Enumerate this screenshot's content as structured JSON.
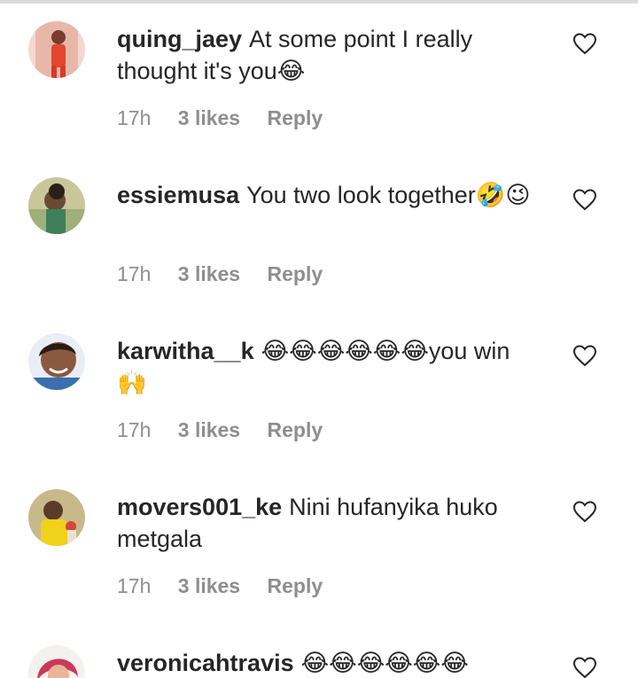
{
  "comments": [
    {
      "user": "quing_jaey",
      "text": "At some point I really thought it's you😂",
      "time": "17h",
      "likes": "3 likes",
      "reply": "Reply"
    },
    {
      "user": "essiemusa",
      "text": "You two look together🤣😉",
      "time": "17h",
      "likes": "3 likes",
      "reply": "Reply"
    },
    {
      "user": "karwitha__k",
      "text": "😂😂😂😂😂😂you win 🙌",
      "time": "17h",
      "likes": "3 likes",
      "reply": "Reply"
    },
    {
      "user": "movers001_ke",
      "text": "Nini hufanyika huko metgala",
      "time": "17h",
      "likes": "3 likes",
      "reply": "Reply"
    },
    {
      "user": "veronicahtravis",
      "text": "😂😂😂😂😂😂",
      "time": "",
      "likes": "",
      "reply": ""
    }
  ],
  "icons": {
    "like": "heart-outline-icon"
  },
  "colors": {
    "text": "#262626",
    "meta": "#8e8e8e",
    "divider": "#dbdbdb"
  }
}
